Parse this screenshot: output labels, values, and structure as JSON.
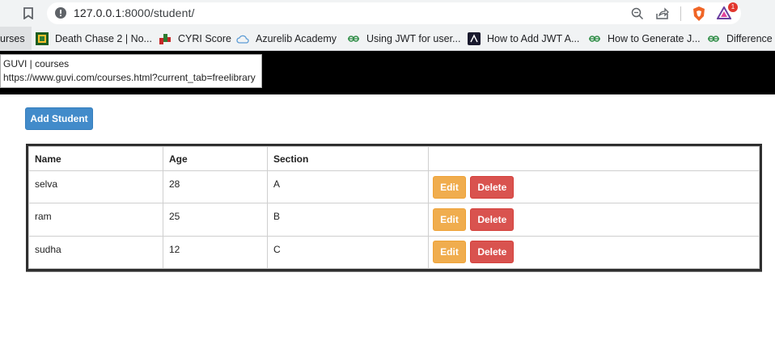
{
  "browser": {
    "url_host": "127.0.0.1",
    "url_rest": ":8000/student/",
    "extension_badge": "1"
  },
  "bookmarks": [
    {
      "label": "urses",
      "icon": "page-icon"
    },
    {
      "label": "Death Chase 2 | No...",
      "icon": "game-icon"
    },
    {
      "label": "CYRI Score",
      "icon": "score-icon"
    },
    {
      "label": "Azurelib Academy",
      "icon": "cloud-icon"
    },
    {
      "label": "Using JWT for user...",
      "icon": "gfg-icon"
    },
    {
      "label": "How to Add JWT A...",
      "icon": "site-icon"
    },
    {
      "label": "How to Generate J...",
      "icon": "gfg-icon"
    },
    {
      "label": "Difference b",
      "icon": "gfg-icon"
    }
  ],
  "tooltip": {
    "title": "GUVI | courses",
    "url": "https://www.guvi.com/courses.html?current_tab=freelibrary"
  },
  "page": {
    "add_button": "Add Student",
    "table": {
      "headers": [
        "Name",
        "Age",
        "Section",
        ""
      ],
      "rows": [
        {
          "name": "selva",
          "age": "28",
          "section": "A"
        },
        {
          "name": "ram",
          "age": "25",
          "section": "B"
        },
        {
          "name": "sudha",
          "age": "12",
          "section": "C"
        }
      ],
      "edit_label": "Edit",
      "delete_label": "Delete"
    }
  },
  "colors": {
    "primary": "#428bca",
    "warning": "#f0ad4e",
    "danger": "#d9534f",
    "header_band": "#000000"
  }
}
